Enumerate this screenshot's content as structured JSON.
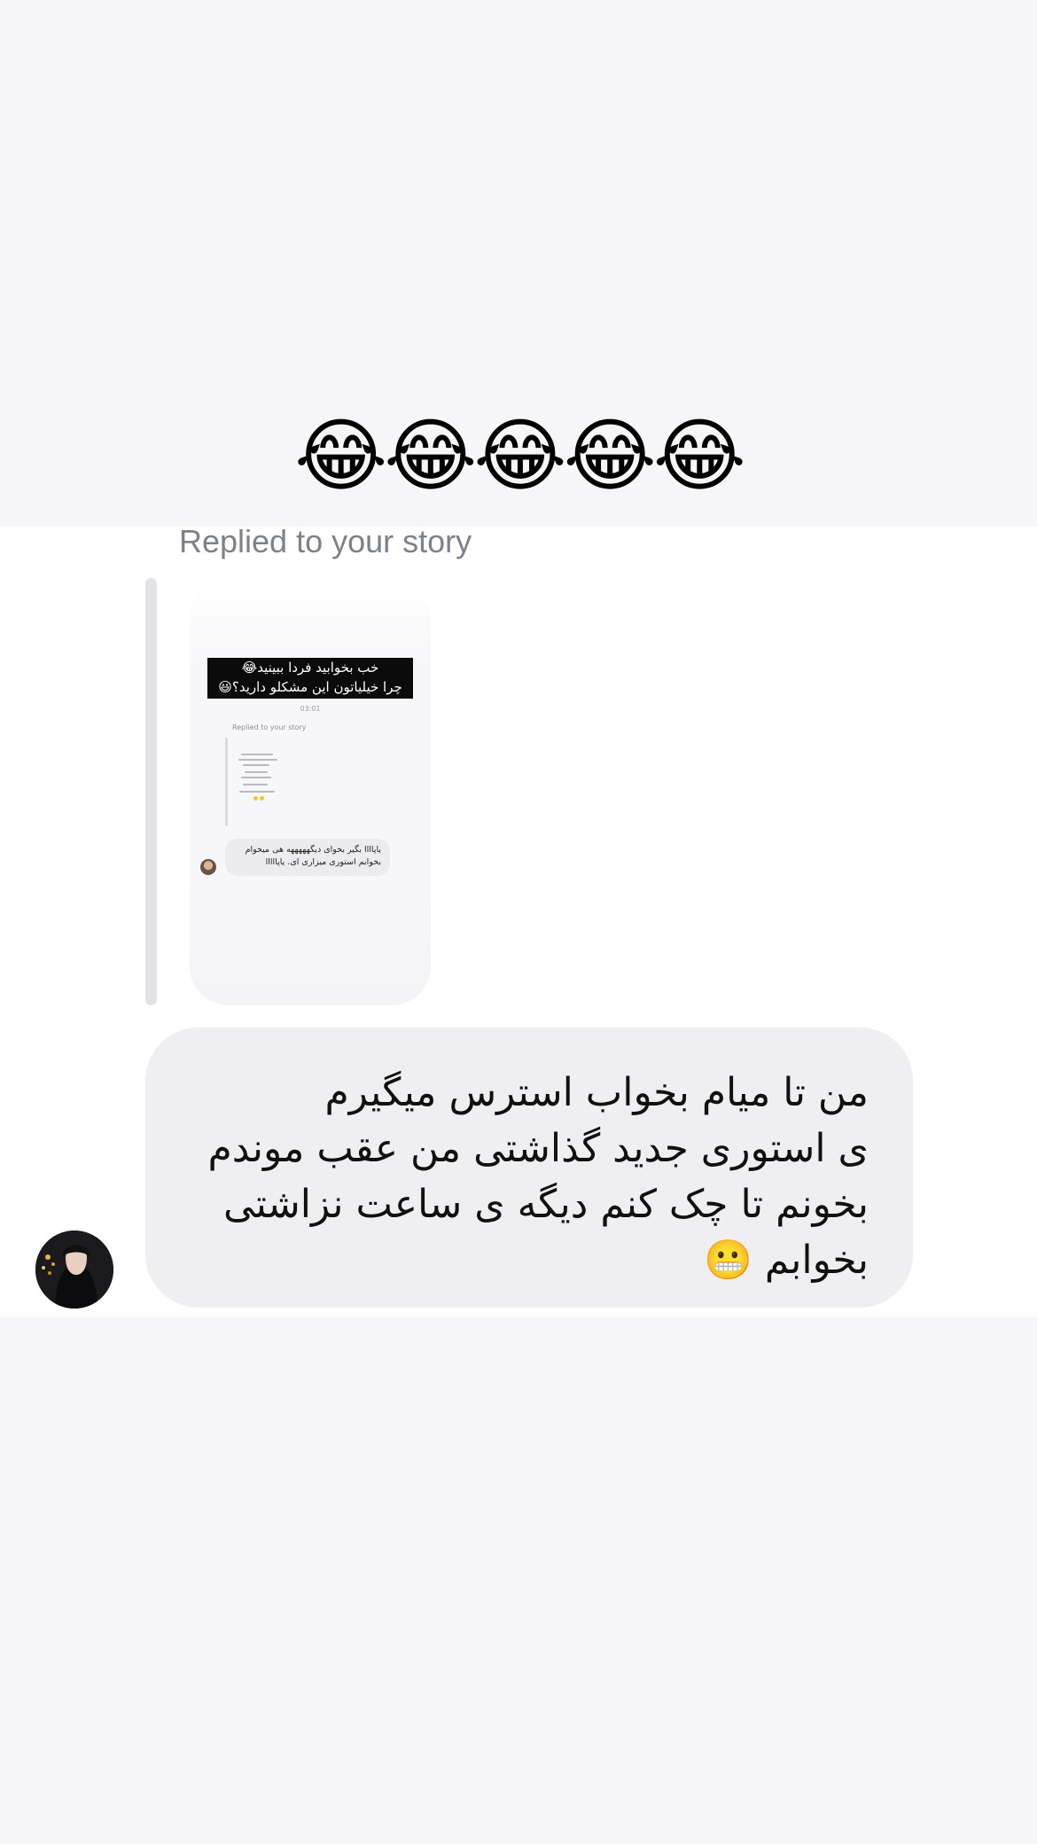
{
  "top_emoji": "😂😂😂😂😂",
  "reply_context": {
    "label": "Replied to your story"
  },
  "story_preview": {
    "banner_line1": "خب بخوابید فردا ببینید😂",
    "banner_line2": "چرا خیلیاتون این مشکلو دارید؟😃",
    "time": "03:01",
    "replied_label": "Replied to your story",
    "reply_line1": "یاپاااا بگیر بخوای دیگهههههه هی میخوام",
    "reply_line2": "بخوابم استوری میزاری ای. یاپااااا"
  },
  "message": {
    "lines": [
      "من تا میام بخواب استرس میگیرم",
      "ی استوری جدید گذاشتی من عقب موندم",
      "بخونم تا چک کنم دیگه ی ساعت نزاشتی",
      "بخوابم 😬"
    ]
  },
  "colors": {
    "page_bg": "#f6f6f8",
    "panel_bg": "#ffffff",
    "bubble_bg": "#efeff2",
    "label_gray": "#7e818a"
  }
}
